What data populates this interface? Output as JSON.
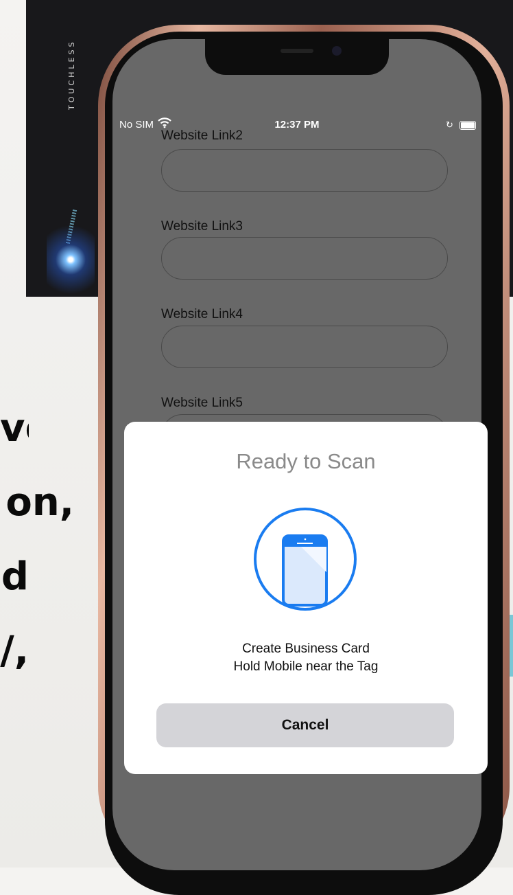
{
  "background": {
    "brand_text": "TOUCHLESS",
    "side_lines": [
      "ve",
      "on,",
      "d",
      "/,"
    ]
  },
  "status_bar": {
    "carrier": "No SIM",
    "time": "12:37 PM",
    "wifi_icon": "wifi-icon",
    "lock_icon": "rotation-lock-icon",
    "battery_icon": "battery-icon"
  },
  "form": {
    "fields": [
      {
        "label": "Website Link2",
        "value": ""
      },
      {
        "label": "Website Link3",
        "value": ""
      },
      {
        "label": "Website Link4",
        "value": ""
      },
      {
        "label": "Website Link5",
        "value": ""
      }
    ]
  },
  "scan_sheet": {
    "title": "Ready to Scan",
    "icon": "phone-scan-icon",
    "message_line1": "Create Business Card",
    "message_line2": "Hold Mobile near the Tag",
    "cancel_label": "Cancel",
    "accent_color": "#1a7cf0"
  }
}
